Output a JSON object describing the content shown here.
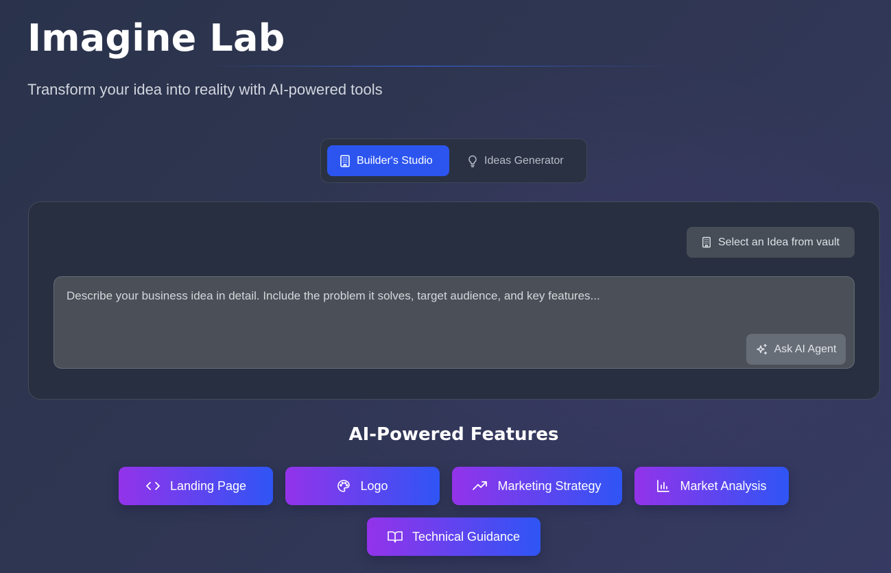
{
  "header": {
    "title": "Imagine Lab",
    "subtitle": "Transform your idea into reality with AI-powered tools"
  },
  "modes": {
    "active": "Builder's Studio",
    "tabs": [
      {
        "label": "Builder's Studio",
        "icon": "building-icon",
        "active": true
      },
      {
        "label": "Ideas Generator",
        "icon": "lightbulb-icon",
        "active": false
      }
    ]
  },
  "builder": {
    "vault_button_label": "Select an Idea from vault",
    "vault_button_icon": "building-icon",
    "idea_placeholder": "Describe your business idea in detail. Include the problem it solves, target audience, and key features...",
    "idea_value": "",
    "ask_button_label": "Ask AI Agent",
    "ask_button_icon": "sparkles-icon"
  },
  "features": {
    "title": "AI-Powered Features",
    "items": [
      {
        "label": "Landing Page",
        "icon": "code-icon"
      },
      {
        "label": "Logo",
        "icon": "palette-icon"
      },
      {
        "label": "Marketing Strategy",
        "icon": "trending-up-icon"
      },
      {
        "label": "Market Analysis",
        "icon": "bar-chart-icon"
      },
      {
        "label": "Technical Guidance",
        "icon": "book-open-icon"
      }
    ]
  },
  "colors": {
    "accent_blue": "#2c55f0",
    "gradient_start": "#9333ea",
    "gradient_end": "#2f55f5",
    "panel_bg": "#272f40"
  }
}
